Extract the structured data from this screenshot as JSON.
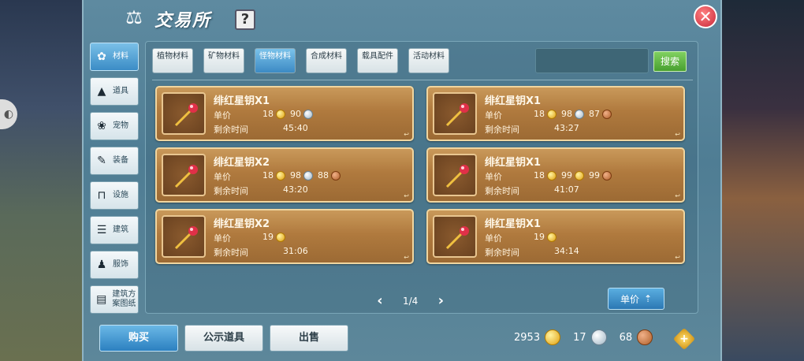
{
  "title": "交易所",
  "help_label": "?",
  "close_label": "✕",
  "nav": [
    {
      "label": "材料",
      "icon": "material-icon",
      "active": true
    },
    {
      "label": "道具",
      "icon": "tool-icon",
      "active": false
    },
    {
      "label": "宠物",
      "icon": "paw-icon",
      "active": false
    },
    {
      "label": "装备",
      "icon": "equipment-icon",
      "active": false
    },
    {
      "label": "设施",
      "icon": "facility-icon",
      "active": false
    },
    {
      "label": "建筑",
      "icon": "building-icon",
      "active": false
    },
    {
      "label": "服饰",
      "icon": "clothing-icon",
      "active": false
    },
    {
      "label": "建筑方案图纸",
      "icon": "blueprint-icon",
      "active": false
    }
  ],
  "tabs": [
    {
      "label": "植物材料",
      "active": false
    },
    {
      "label": "矿物材料",
      "active": false
    },
    {
      "label": "怪物材料",
      "active": true
    },
    {
      "label": "合成材料",
      "active": false
    },
    {
      "label": "载具配件",
      "active": false
    },
    {
      "label": "活动材料",
      "active": false
    }
  ],
  "search": {
    "placeholder": "",
    "button_label": "搜索"
  },
  "labels": {
    "unit_price": "单价",
    "remaining_time": "剩余时间"
  },
  "listings": [
    {
      "name": "绯红星钥X1",
      "gold": "18",
      "silver": "90",
      "copper": null,
      "time": "45:40"
    },
    {
      "name": "绯红星钥X1",
      "gold": "18",
      "silver": "98",
      "copper": "87",
      "time": "43:27"
    },
    {
      "name": "绯红星钥X2",
      "gold": "18",
      "silver": "98",
      "copper": "88",
      "time": "43:20"
    },
    {
      "name": "绯红星钥X1",
      "gold": "18",
      "silver": "99",
      "copper": "99",
      "time": "41:07"
    },
    {
      "name": "绯红星钥X2",
      "gold": "19",
      "silver": null,
      "copper": null,
      "time": "31:06"
    },
    {
      "name": "绯红星钥X1",
      "gold": "19",
      "silver": null,
      "copper": null,
      "time": "34:14"
    }
  ],
  "pager": {
    "text": "1/4"
  },
  "sort_label": "单价",
  "actions": {
    "buy": "购买",
    "public": "公示道具",
    "sell": "出售"
  },
  "wallet": {
    "gold": "2953",
    "silver": "17",
    "copper": "68"
  },
  "colors": {
    "gold": "#e0a010",
    "silver": "#9fb6c6",
    "copper": "#b0602a",
    "accent": "#3c8ac4"
  }
}
